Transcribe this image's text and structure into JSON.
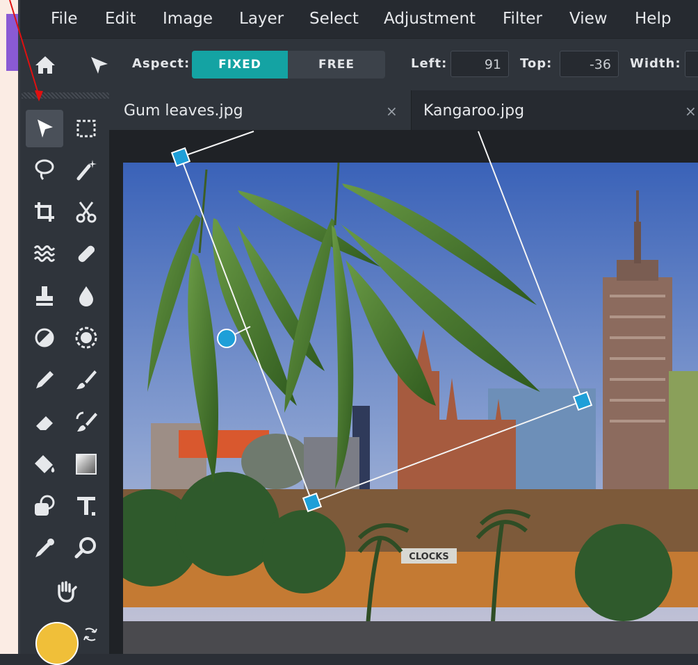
{
  "menu": [
    "File",
    "Edit",
    "Image",
    "Layer",
    "Select",
    "Adjustment",
    "Filter",
    "View",
    "Help"
  ],
  "toolbar": {
    "aspect_label": "Aspect:",
    "fixed_label": "FIXED",
    "free_label": "FREE",
    "aspect_selected": "FIXED",
    "left_label": "Left:",
    "left_value": "91",
    "top_label": "Top:",
    "top_value": "-36",
    "width_label": "Width:",
    "width_value": ""
  },
  "tabs": [
    {
      "label": "Gum leaves.jpg",
      "close": "×"
    },
    {
      "label": "Kangaroo.jpg",
      "close": "×"
    }
  ],
  "tools": [
    "move-tool",
    "marquee-tool",
    "lasso-tool",
    "magic-wand-tool",
    "crop-tool",
    "cut-tool",
    "liquify-tool",
    "heal-tool",
    "stamp-tool",
    "blur-tool",
    "sponge-tool",
    "dodge-tool",
    "pencil-tool",
    "brush-tool",
    "eraser-tool",
    "color-replace-tool",
    "fill-tool",
    "gradient-tool",
    "shape-tool",
    "text-tool",
    "eyedropper-tool",
    "zoom-tool",
    "hand-tool"
  ],
  "photo": {
    "sky_top": "#3a62b8",
    "sky_bottom": "#a9b6d3",
    "leaf_color": "#4c7a2f",
    "building_color": "#9a5a3f"
  },
  "text": {
    "clock_sign": "CLOCKS"
  },
  "colors": {
    "accent": "#14a3a3",
    "foreground_swatch": "#f0bf39",
    "handle": "#1e9fd8"
  }
}
